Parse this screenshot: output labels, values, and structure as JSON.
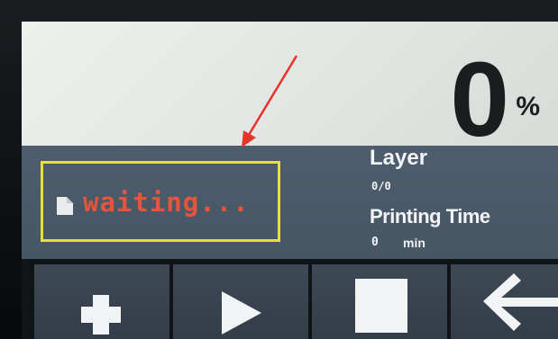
{
  "progress": {
    "value": "0",
    "unit": "%"
  },
  "status": {
    "text": "waiting..."
  },
  "layer": {
    "label": "Layer",
    "value": "0/0"
  },
  "printing_time": {
    "label": "Printing Time",
    "value": "0",
    "unit": "min"
  },
  "toolbar": {
    "buttons": [
      {
        "name": "add",
        "icon": "plus-icon"
      },
      {
        "name": "play",
        "icon": "play-icon"
      },
      {
        "name": "stop",
        "icon": "stop-icon"
      },
      {
        "name": "back",
        "icon": "back-arrow-icon"
      }
    ]
  },
  "colors": {
    "status_text": "#e5553b",
    "highlight_box": "#e3e13a",
    "annotation_arrow": "#e8332a",
    "info_panel": "#4e5d6d"
  }
}
